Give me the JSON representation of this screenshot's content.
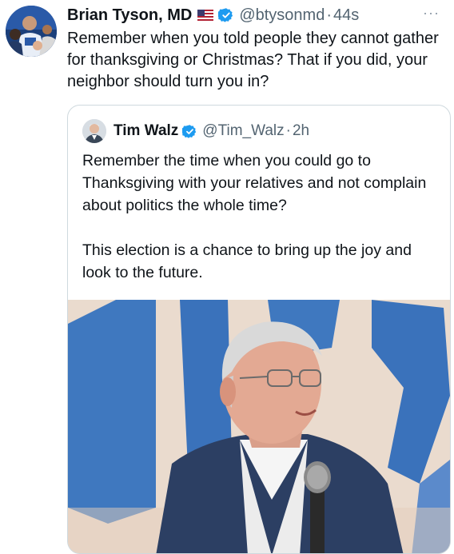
{
  "tweet": {
    "author_name": "Brian Tyson, MD",
    "handle": "@btysonmd",
    "separator": "·",
    "time": "44s",
    "more_label": "···",
    "text": "Remember when you told people they cannot gather for thanksgiving or Christmas? That if you did, your neighbor should turn you in?",
    "flag_icon": "us-flag-icon",
    "verified_icon": "verified-badge-icon"
  },
  "quoted_tweet": {
    "author_name": "Tim Walz",
    "handle": "@Tim_Walz",
    "separator": "·",
    "time": "2h",
    "paragraph_1": "Remember the time when you could go to Thanksgiving with your relatives and not complain about politics the whole time?",
    "paragraph_2": "This election is a chance to bring up the joy and look to the future.",
    "verified_icon": "verified-badge-icon"
  },
  "colors": {
    "verified_blue": "#1d9bf0",
    "text": "#0f1419",
    "secondary_text": "#536471",
    "border": "#cfd9de"
  }
}
